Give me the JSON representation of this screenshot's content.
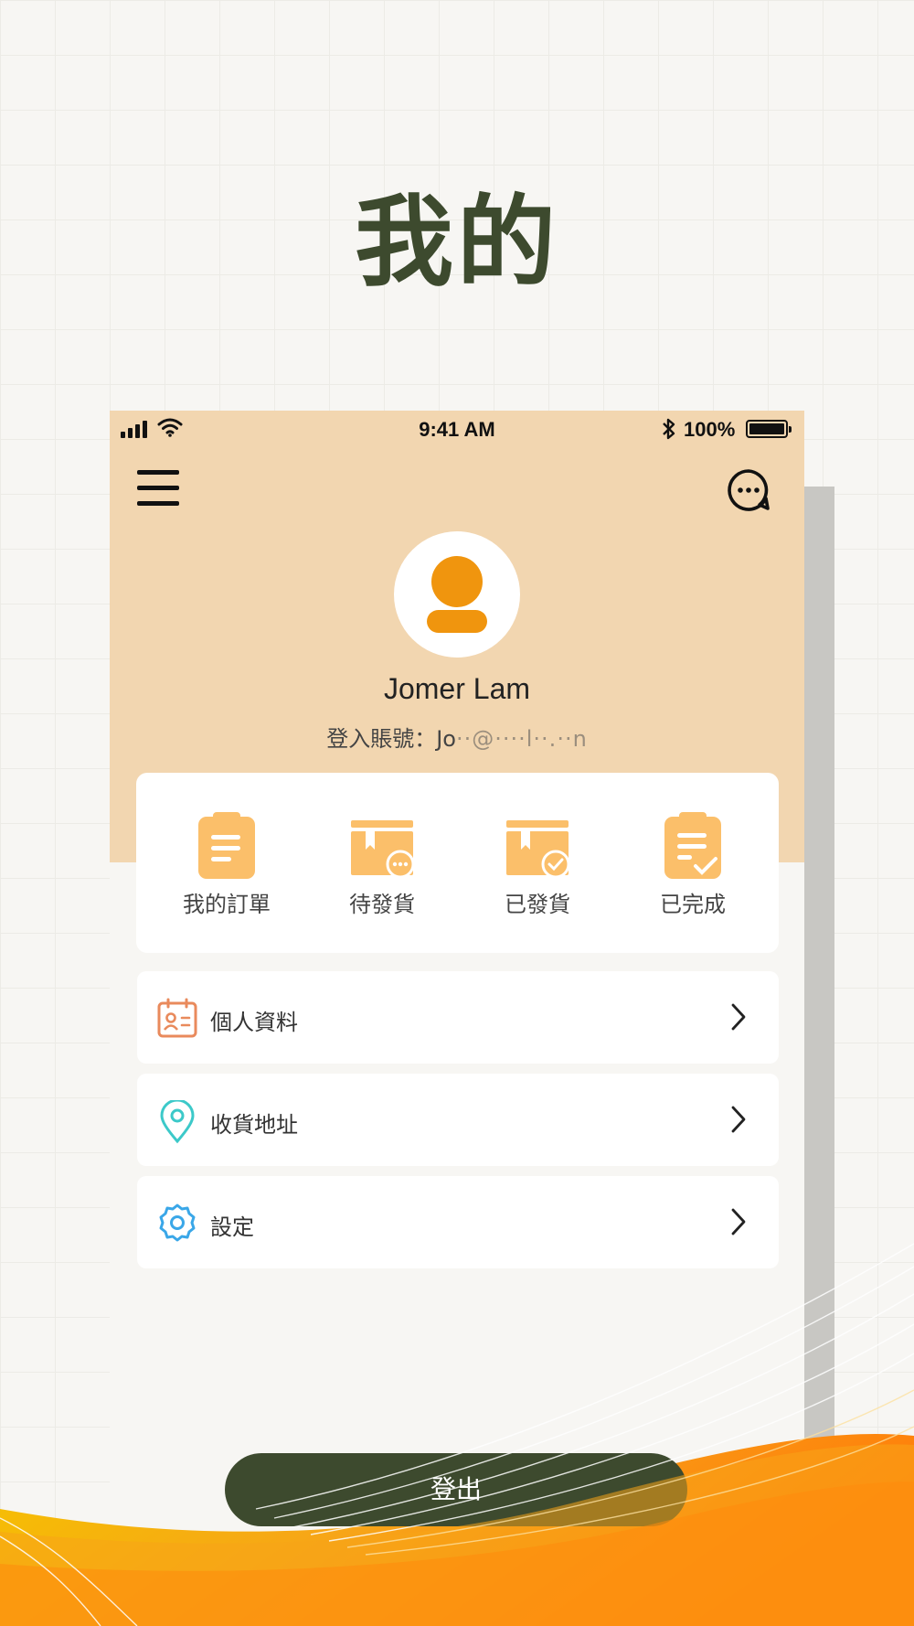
{
  "page_title": "我的",
  "status_bar": {
    "time": "9:41 AM",
    "battery": "100%"
  },
  "profile": {
    "name": "Jomer Lam",
    "account_label": "登入賬號：",
    "account_value": "Jo",
    "account_masked": "··@····l··.··n"
  },
  "orders": [
    {
      "label": "我的訂單",
      "icon": "clipboard-list-icon"
    },
    {
      "label": "待發貨",
      "icon": "box-pending-icon"
    },
    {
      "label": "已發貨",
      "icon": "box-shipped-icon"
    },
    {
      "label": "已完成",
      "icon": "clipboard-check-icon"
    }
  ],
  "menu": [
    {
      "label": "個人資料",
      "icon": "profile-card-icon",
      "color": "#e98a5c"
    },
    {
      "label": "收貨地址",
      "icon": "location-pin-icon",
      "color": "#3cc9c9"
    },
    {
      "label": "設定",
      "icon": "settings-gear-icon",
      "color": "#3aa7e8"
    }
  ],
  "logout_label": "登出",
  "colors": {
    "accent_dark": "#3d4a2e",
    "header_bg": "#f2d6b0",
    "avatar_orange": "#f0950e",
    "order_icon": "#fbbf6a",
    "wave_orange": "#f7a418"
  }
}
